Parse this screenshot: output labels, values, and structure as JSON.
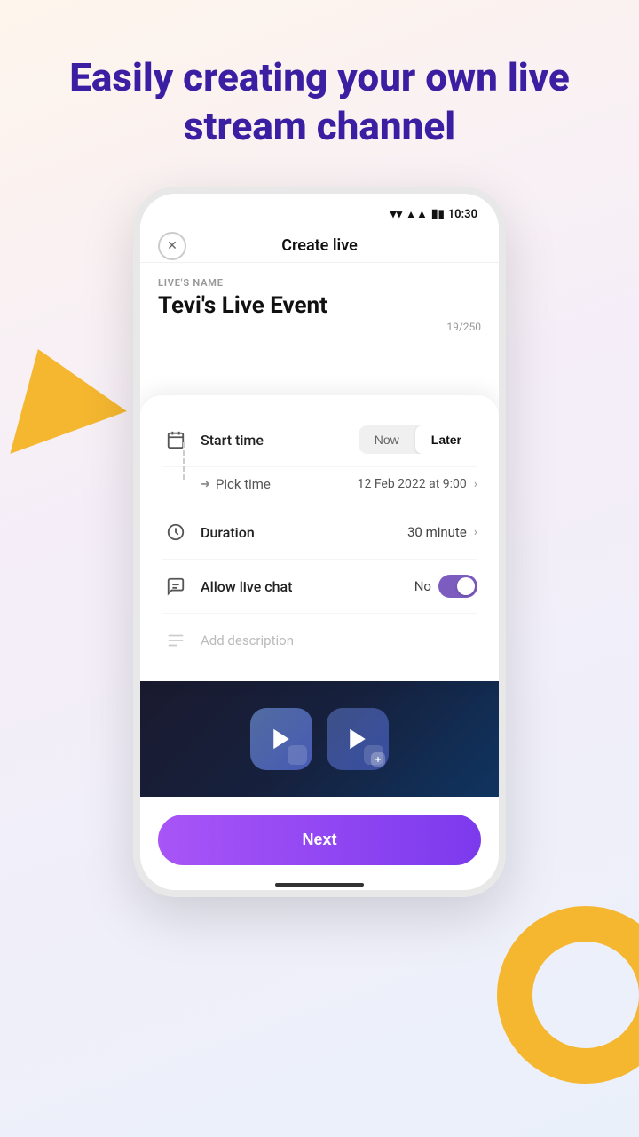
{
  "hero": {
    "title": "Easily creating your own live stream channel"
  },
  "status_bar": {
    "time": "10:30"
  },
  "header": {
    "title": "Create live",
    "close_label": "×"
  },
  "form": {
    "live_name_label": "LIVE'S NAME",
    "live_name_value": "Tevi's Live Event",
    "char_count": "19/250"
  },
  "bottom_card": {
    "start_time_label": "Start time",
    "now_label": "Now",
    "later_label": "Later",
    "pick_time_label": "Pick time",
    "pick_time_value": "12 Feb 2022 at 9:00",
    "duration_label": "Duration",
    "duration_value": "30 minute",
    "allow_chat_label": "Allow live chat",
    "allow_chat_status": "No",
    "description_placeholder": "Add description"
  },
  "next_button": {
    "label": "Next"
  }
}
